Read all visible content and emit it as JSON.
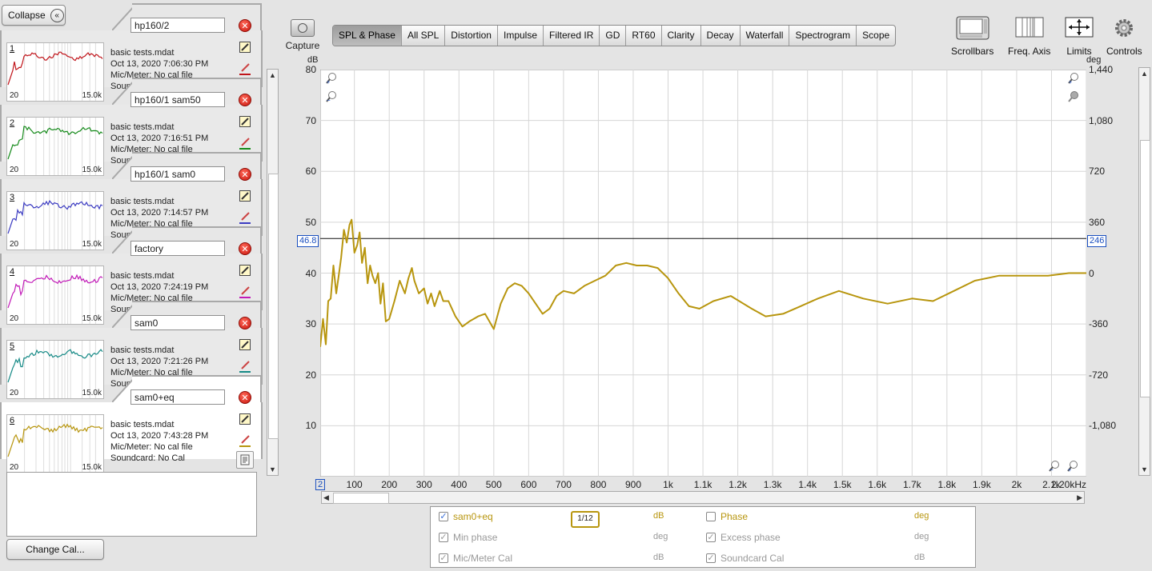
{
  "collapse_label": "Collapse",
  "measurements": [
    {
      "id": "1",
      "name": "hp160/2",
      "file": "basic tests.mdat",
      "date": "Oct 13, 2020 7:06:30 PM",
      "mic": "Mic/Meter: No cal file",
      "sound": "Soundcard: No Cal",
      "color": "#c0141a",
      "x_lo": "20",
      "x_hi": "15.0k"
    },
    {
      "id": "2",
      "name": "hp160/1 sam50",
      "file": "basic tests.mdat",
      "date": "Oct 13, 2020 7:16:51 PM",
      "mic": "Mic/Meter: No cal file",
      "sound": "Soundcard: No Cal",
      "color": "#158a1a",
      "x_lo": "20",
      "x_hi": "15.0k"
    },
    {
      "id": "3",
      "name": "hp160/1 sam0",
      "file": "basic tests.mdat",
      "date": "Oct 13, 2020 7:14:57 PM",
      "mic": "Mic/Meter: No cal file",
      "sound": "Soundcard: No Cal",
      "color": "#3c3cc2",
      "x_lo": "20",
      "x_hi": "15.0k"
    },
    {
      "id": "4",
      "name": "factory",
      "file": "basic tests.mdat",
      "date": "Oct 13, 2020 7:24:19 PM",
      "mic": "Mic/Meter: No cal file",
      "sound": "Soundcard: No Cal",
      "color": "#c21cb8",
      "x_lo": "20",
      "x_hi": "15.0k"
    },
    {
      "id": "5",
      "name": "sam0",
      "file": "basic tests.mdat",
      "date": "Oct 13, 2020 7:21:26 PM",
      "mic": "Mic/Meter: No cal file",
      "sound": "Soundcard: No Cal",
      "color": "#168a86",
      "x_lo": "20",
      "x_hi": "15.0k"
    },
    {
      "id": "6",
      "name": "sam0+eq",
      "file": "basic tests.mdat",
      "date": "Oct 13, 2020 7:43:28 PM",
      "mic": "Mic/Meter: No cal file",
      "sound": "Soundcard: No Cal",
      "color": "#b8960f",
      "x_lo": "20",
      "x_hi": "15.0k"
    }
  ],
  "change_cal_label": "Change Cal...",
  "capture_label": "Capture",
  "tabs": [
    "SPL & Phase",
    "All SPL",
    "Distortion",
    "Impulse",
    "Filtered IR",
    "GD",
    "RT60",
    "Clarity",
    "Decay",
    "Waterfall",
    "Spectrogram",
    "Scope"
  ],
  "selected_tab": "SPL & Phase",
  "tools": {
    "scrollbars": "Scrollbars",
    "freq_axis": "Freq. Axis",
    "limits": "Limits",
    "controls": "Controls"
  },
  "icons": [
    "camera-icon",
    "scrollbars-icon",
    "freq-axis-icon",
    "limits-icon",
    "gear-icon",
    "zoom-in-icon",
    "zoom-out-icon",
    "close-icon",
    "edit-icon",
    "pen-icon",
    "report-icon"
  ],
  "chart_data": {
    "type": "line",
    "ylabel": "dB",
    "y2label": "deg",
    "ylim": [
      0,
      80
    ],
    "y2lim": [
      -1440,
      1440
    ],
    "xlim": [
      2,
      2200
    ],
    "xunit": "kHz",
    "y_ticks": [
      "80",
      "70",
      "60",
      "50",
      "40",
      "30",
      "20",
      "10"
    ],
    "y2_ticks": [
      "1,440",
      "1,080",
      "720",
      "360",
      "0",
      "-360",
      "-720",
      "-1,080"
    ],
    "x_ticks": [
      "2",
      "100",
      "200",
      "300",
      "400",
      "500",
      "600",
      "700",
      "800",
      "900",
      "1k",
      "1.1k",
      "1.2k",
      "1.3k",
      "1.4k",
      "1.5k",
      "1.6k",
      "1.7k",
      "1.8k",
      "1.9k",
      "2k",
      "2.1k",
      "2.20kHz"
    ],
    "cursor_left": "46.8",
    "cursor_right": "246",
    "cursor_y": 46.8,
    "grid": true,
    "series": [
      {
        "name": "sam0+eq",
        "color": "#b8960f",
        "x": [
          2,
          10,
          18,
          25,
          32,
          40,
          48,
          55,
          62,
          70,
          78,
          86,
          92,
          100,
          108,
          115,
          122,
          130,
          138,
          145,
          152,
          160,
          168,
          175,
          182,
          190,
          200,
          215,
          230,
          245,
          255,
          265,
          272,
          285,
          300,
          310,
          320,
          330,
          345,
          355,
          370,
          390,
          410,
          430,
          455,
          475,
          500,
          520,
          540,
          560,
          580,
          600,
          620,
          640,
          660,
          680,
          700,
          730,
          760,
          790,
          820,
          850,
          880,
          910,
          940,
          970,
          1000,
          1030,
          1060,
          1090,
          1130,
          1180,
          1240,
          1280,
          1330,
          1380,
          1430,
          1490,
          1560,
          1630,
          1700,
          1760,
          1820,
          1880,
          1950,
          2020,
          2090,
          2150,
          2200
        ],
        "y": [
          25.5,
          31,
          26,
          34.5,
          35,
          41.5,
          36,
          39.5,
          43,
          48.5,
          46,
          49.5,
          50.5,
          44,
          45.5,
          48,
          42,
          45,
          38,
          41.5,
          39.5,
          38,
          40,
          34,
          38,
          30.5,
          31,
          34.5,
          38.5,
          36,
          39,
          41,
          38.5,
          36,
          37,
          34,
          36,
          33.5,
          36.5,
          34.5,
          34.5,
          31.5,
          29.5,
          30.5,
          31.5,
          32,
          29,
          34,
          37,
          38,
          37.5,
          36,
          34,
          32,
          33,
          35.5,
          36.5,
          36,
          37.5,
          38.5,
          39.5,
          41.5,
          42,
          41.5,
          41.5,
          41,
          39,
          36,
          33.5,
          33,
          34.5,
          35.5,
          33,
          31.5,
          32,
          33.5,
          35,
          36.5,
          35,
          34,
          35,
          34.5,
          36.5,
          38.5,
          39.5,
          39.5,
          39.5,
          40,
          40
        ]
      }
    ]
  },
  "legend": {
    "items": [
      {
        "label": "sam0+eq",
        "unit": "dB",
        "checked": true,
        "enabled": true,
        "color": "#b8960f"
      },
      {
        "label": "Phase",
        "unit": "deg",
        "checked": false,
        "enabled": true,
        "color": "#b8960f"
      },
      {
        "label": "Min phase",
        "unit": "deg",
        "checked": true,
        "enabled": false,
        "color": "#999999"
      },
      {
        "label": "Excess phase",
        "unit": "deg",
        "checked": true,
        "enabled": false,
        "color": "#999999"
      },
      {
        "label": "Mic/Meter Cal",
        "unit": "dB",
        "checked": true,
        "enabled": false,
        "color": "#999999"
      },
      {
        "label": "Soundcard Cal",
        "unit": "dB",
        "checked": true,
        "enabled": false,
        "color": "#999999"
      }
    ],
    "smoothing_num": "1",
    "smoothing_den": "12"
  }
}
